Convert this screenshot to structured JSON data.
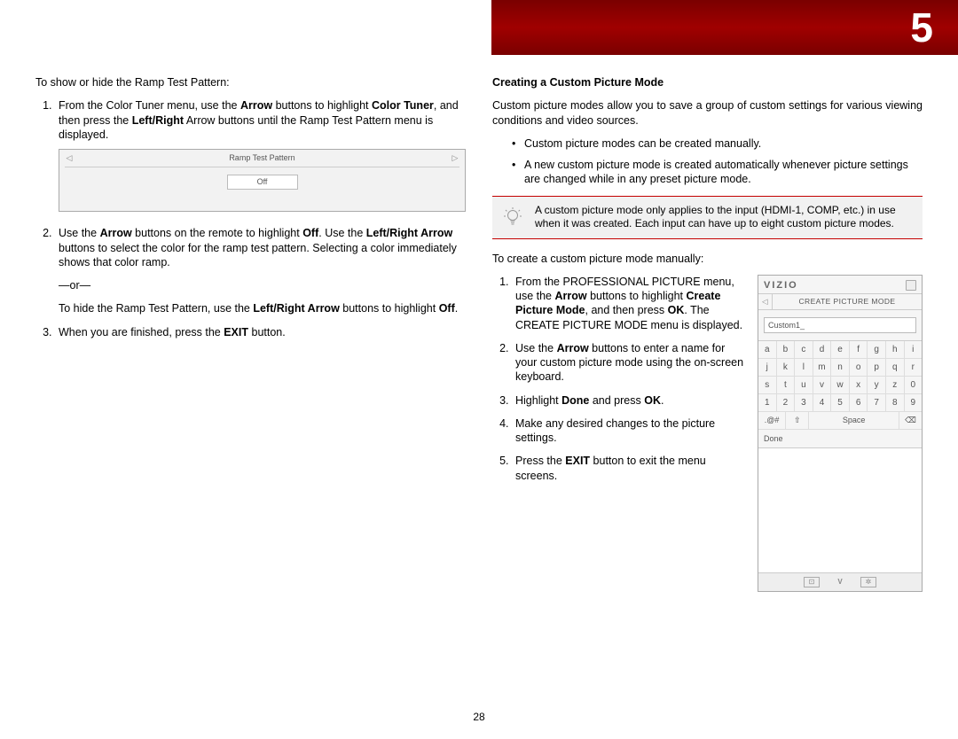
{
  "chapter_number": "5",
  "page_number": "28",
  "left": {
    "intro": "To show or hide the Ramp Test Pattern:",
    "steps": {
      "s1a": "From the Color Tuner menu, use the ",
      "s1b": "Arrow",
      "s1c": " buttons to highlight ",
      "s1d": "Color Tuner",
      "s1e": ", and then press the ",
      "s1f": "Left/Right",
      "s1g": " Arrow buttons until the Ramp Test Pattern menu is displayed.",
      "s2a": "Use the ",
      "s2b": "Arrow",
      "s2c": " buttons on the remote to highlight ",
      "s2d": "Off",
      "s2e": ". Use the ",
      "s2f": "Left/Right Arrow",
      "s2g": " buttons to select the color for the ramp test pattern. Selecting a color immediately shows that color ramp.",
      "or": "—or—",
      "s2h": "To hide the Ramp Test Pattern, use the ",
      "s2i": "Left/Right Arrow",
      "s2j": " buttons to highlight ",
      "s2k": "Off",
      "s2l": ".",
      "s3a": "When you are finished, press the ",
      "s3b": "EXIT",
      "s3c": " button."
    },
    "ramp_widget": {
      "title": "Ramp Test Pattern",
      "value": "Off"
    }
  },
  "right": {
    "heading": "Creating a Custom Picture Mode",
    "desc": "Custom picture modes allow you to save a group of custom settings for various viewing conditions and video sources.",
    "bullets": [
      "Custom picture modes can be created manually.",
      "A new custom picture mode is created automatically whenever picture settings are changed while in any preset picture mode."
    ],
    "tip": "A custom picture mode only applies to the input (HDMI-1, COMP, etc.) in use when it was created. Each input can have up to eight custom picture modes.",
    "create_intro": "To create a custom picture mode manually:",
    "csteps": {
      "c1a": "From the PROFESSIONAL PICTURE menu, use the ",
      "c1b": "Arrow",
      "c1c": " buttons to highlight ",
      "c1d": "Create Picture Mode",
      "c1e": ", and then press ",
      "c1f": "OK",
      "c1g": ". The CREATE PICTURE MODE menu is displayed.",
      "c2a": "Use the ",
      "c2b": "Arrow",
      "c2c": " buttons to enter a name for your custom picture mode using the on-screen keyboard.",
      "c3a": "Highlight ",
      "c3b": "Done",
      "c3c": " and press ",
      "c3d": "OK",
      "c3e": ".",
      "c4": "Make any desired changes to the picture settings.",
      "c5a": "Press the ",
      "c5b": "EXIT",
      "c5c": " button to exit the menu screens."
    },
    "osd": {
      "brand": "VIZIO",
      "sub": "CREATE PICTURE MODE",
      "input_value": "Custom1_",
      "keyboard": {
        "rows": [
          [
            "a",
            "b",
            "c",
            "d",
            "e",
            "f",
            "g",
            "h",
            "i"
          ],
          [
            "j",
            "k",
            "l",
            "m",
            "n",
            "o",
            "p",
            "q",
            "r"
          ],
          [
            "s",
            "t",
            "u",
            "v",
            "w",
            "x",
            "y",
            "z",
            "0"
          ],
          [
            "1",
            "2",
            "3",
            "4",
            "5",
            "6",
            "7",
            "8",
            "9"
          ]
        ],
        "func": {
          "sym": ".@#",
          "shift": "⇧",
          "space": "Space",
          "del": "⌫"
        }
      },
      "done": "Done"
    }
  }
}
